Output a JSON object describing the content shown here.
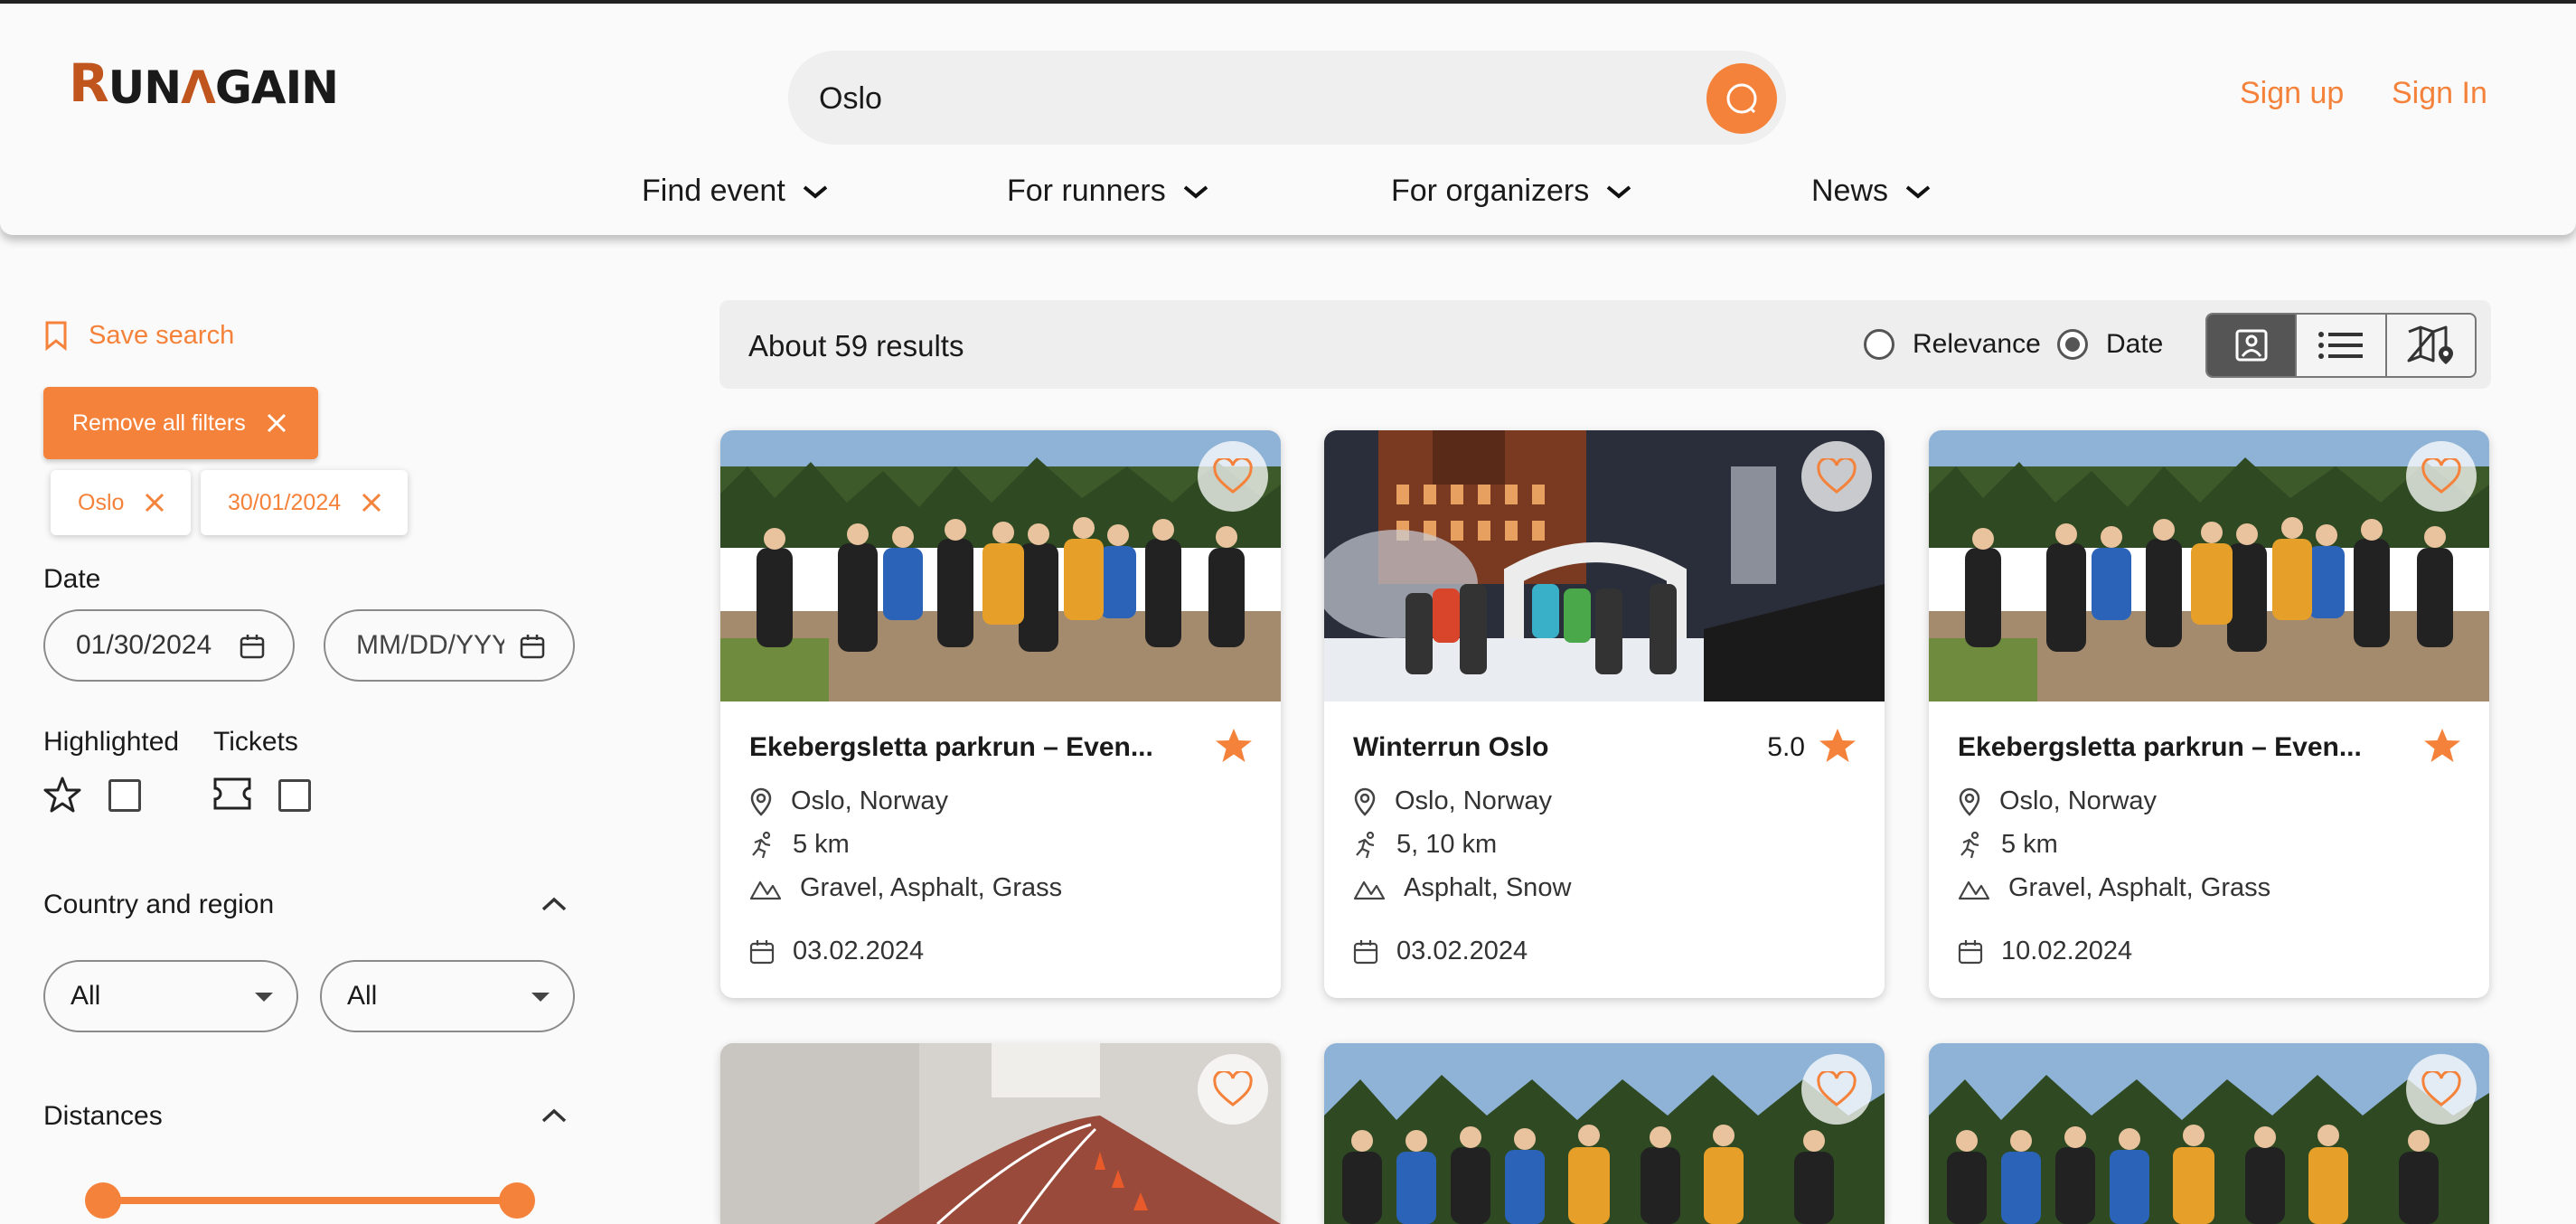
{
  "header": {
    "logo": "RUNAGAIN",
    "search": {
      "value": "Oslo"
    },
    "signup": "Sign up",
    "signin": "Sign In",
    "nav": [
      "Find event",
      "For runners",
      "For organizers",
      "News"
    ]
  },
  "sidebar": {
    "save_search": "Save search",
    "remove_all": "Remove all filters",
    "chips": [
      "Oslo",
      "30/01/2024"
    ],
    "date_label": "Date",
    "date_from": "01/30/2024",
    "date_to_placeholder": "MM/DD/YYYY",
    "highlighted_label": "Highlighted",
    "tickets_label": "Tickets",
    "country_region_label": "Country and region",
    "country_value": "All",
    "region_value": "All",
    "distances_label": "Distances"
  },
  "results": {
    "count": "About 59 results",
    "sort_relevance": "Relevance",
    "sort_date": "Date",
    "selected_sort": "Date",
    "view_modes": [
      "gallery",
      "list",
      "map"
    ],
    "active_view": "gallery"
  },
  "cards": [
    {
      "title": "Ekebergsletta parkrun – Even...",
      "rating": "",
      "location": "Oslo, Norway",
      "distance": "5 km",
      "surface": "Gravel, Asphalt, Grass",
      "date": "03.02.2024",
      "image": "forest-runners"
    },
    {
      "title": "Winterrun Oslo",
      "rating": "5.0",
      "location": "Oslo, Norway",
      "distance": "5, 10 km",
      "surface": "Asphalt, Snow",
      "date": "03.02.2024",
      "image": "night-winter-run"
    },
    {
      "title": "Ekebergsletta parkrun – Even...",
      "rating": "",
      "location": "Oslo, Norway",
      "distance": "5 km",
      "surface": "Gravel, Asphalt, Grass",
      "date": "10.02.2024",
      "image": "forest-runners"
    }
  ],
  "colors": {
    "accent": "#f5823a",
    "logo_accent": "#c0551d"
  }
}
